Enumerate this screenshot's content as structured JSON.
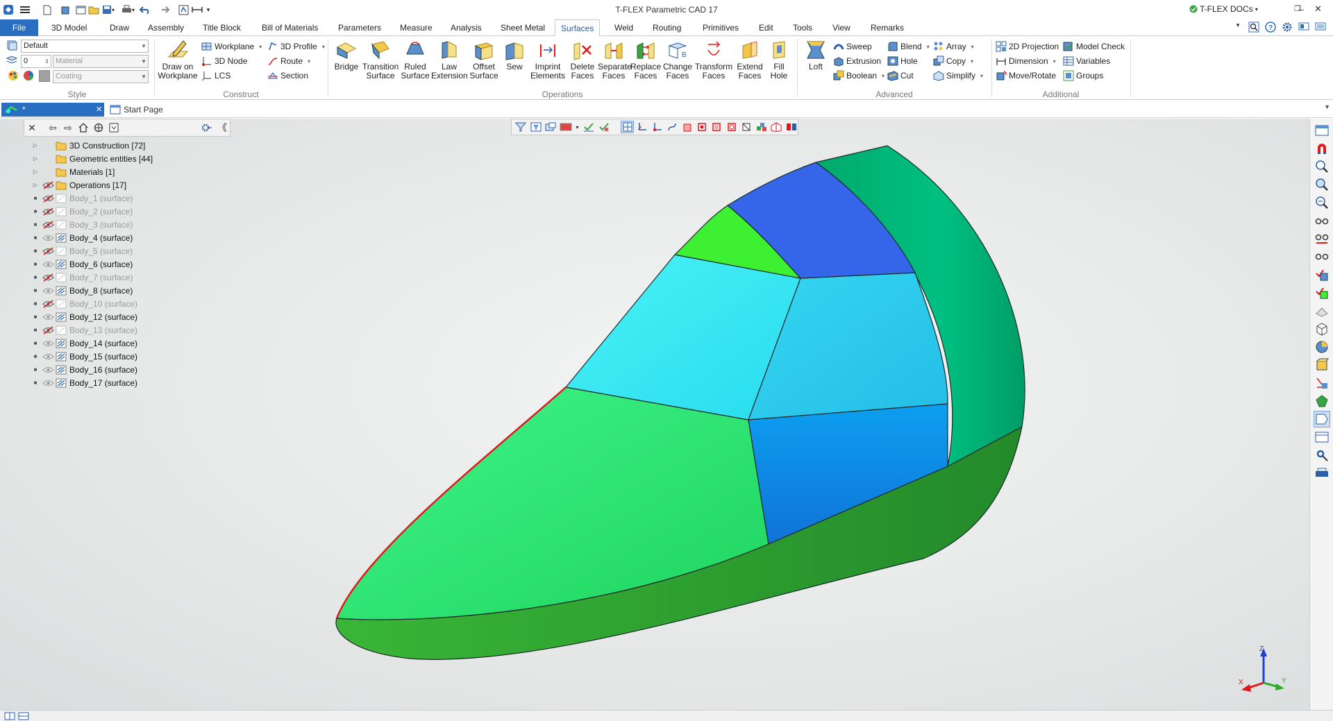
{
  "app": {
    "title": "T-FLEX Parametric CAD 17",
    "docs_label": "T-FLEX DOCs"
  },
  "menu": {
    "file": "File",
    "tabs": [
      "3D Model",
      "Draw",
      "Assembly",
      "Title Block",
      "Bill of Materials",
      "Parameters",
      "Measure",
      "Analysis",
      "Sheet Metal",
      "Surfaces",
      "Weld",
      "Routing",
      "Primitives",
      "Edit",
      "Tools",
      "View",
      "Remarks"
    ],
    "active": "Surfaces"
  },
  "ribbon": {
    "style": {
      "label": "Style",
      "style_value": "Default",
      "layer_value": "0",
      "material_placeholder": "Material",
      "coating_placeholder": "Coating"
    },
    "construct": {
      "label": "Construct",
      "draw_on_workplane": [
        "Draw on",
        "Workplane"
      ],
      "workplane": "Workplane",
      "node3d": "3D Node",
      "lcs": "LCS",
      "profile3d": "3D Profile",
      "route": "Route",
      "section": "Section"
    },
    "operations": {
      "label": "Operations",
      "buttons": [
        [
          "Bridge",
          ""
        ],
        [
          "Transition",
          "Surface"
        ],
        [
          "Ruled",
          "Surface"
        ],
        [
          "Law",
          "Extension"
        ],
        [
          "Offset",
          "Surface"
        ],
        [
          "Sew",
          ""
        ],
        [
          "Imprint",
          "Elements"
        ],
        [
          "Delete",
          "Faces"
        ],
        [
          "Separate",
          "Faces"
        ],
        [
          "Replace",
          "Faces"
        ],
        [
          "Change",
          "Faces"
        ],
        [
          "Transform",
          "Faces"
        ],
        [
          "Extend",
          "Faces"
        ],
        [
          "Fill",
          "Hole"
        ]
      ]
    },
    "advanced": {
      "label": "Advanced",
      "loft": "Loft",
      "sweep": "Sweep",
      "extrusion": "Extrusion",
      "boolean": "Boolean",
      "blend": "Blend",
      "hole": "Hole",
      "cut": "Cut",
      "array": "Array",
      "copy": "Copy",
      "simplify": "Simplify"
    },
    "additional": {
      "label": "Additional",
      "projection2d": "2D Projection",
      "dimension": "Dimension",
      "move_rotate": "Move/Rotate",
      "model_check": "Model Check",
      "variables": "Variables",
      "groups": "Groups"
    }
  },
  "doc_tabs": {
    "active": "*",
    "start_page": "Start Page"
  },
  "tree": [
    {
      "label": "3D Construction [72]",
      "type": "folder",
      "hidden": false,
      "eye": "none"
    },
    {
      "label": "Geometric entities [44]",
      "type": "folder",
      "hidden": false,
      "eye": "none"
    },
    {
      "label": "Materials [1]",
      "type": "folder",
      "hidden": false,
      "eye": "none"
    },
    {
      "label": "Operations [17]",
      "type": "folder",
      "hidden": false,
      "eye": "closed"
    },
    {
      "label": "Body_1 (surface)",
      "type": "body",
      "hidden": true,
      "eye": "closed"
    },
    {
      "label": "Body_2 (surface)",
      "type": "body",
      "hidden": true,
      "eye": "closed"
    },
    {
      "label": "Body_3 (surface)",
      "type": "body",
      "hidden": true,
      "eye": "closed"
    },
    {
      "label": "Body_4 (surface)",
      "type": "body",
      "hidden": false,
      "eye": "open"
    },
    {
      "label": "Body_5 (surface)",
      "type": "body",
      "hidden": true,
      "eye": "closed"
    },
    {
      "label": "Body_6 (surface)",
      "type": "body",
      "hidden": false,
      "eye": "open"
    },
    {
      "label": "Body_7 (surface)",
      "type": "body",
      "hidden": true,
      "eye": "closed"
    },
    {
      "label": "Body_8 (surface)",
      "type": "body",
      "hidden": false,
      "eye": "open"
    },
    {
      "label": "Body_10 (surface)",
      "type": "body",
      "hidden": true,
      "eye": "closed"
    },
    {
      "label": "Body_12 (surface)",
      "type": "body",
      "hidden": false,
      "eye": "open"
    },
    {
      "label": "Body_13 (surface)",
      "type": "body",
      "hidden": true,
      "eye": "closed"
    },
    {
      "label": "Body_14 (surface)",
      "type": "body",
      "hidden": false,
      "eye": "open"
    },
    {
      "label": "Body_15 (surface)",
      "type": "body",
      "hidden": false,
      "eye": "open"
    },
    {
      "label": "Body_16 (surface)",
      "type": "body",
      "hidden": false,
      "eye": "open"
    },
    {
      "label": "Body_17 (surface)",
      "type": "body",
      "hidden": false,
      "eye": "open"
    }
  ],
  "triad": {
    "x": "X",
    "y": "Y",
    "z": "Z"
  },
  "colors": {
    "accent": "#2a6ec1",
    "nose": "#23e068",
    "bottom": "#2fa02f",
    "rim": "#00b877",
    "cyan": "#2ee8ef",
    "sky": "#2ccbec",
    "blue_top": "#3565e8",
    "blue_side": "#0f96e6",
    "lime": "#3ef032",
    "highlight_edge": "#e3161c"
  }
}
